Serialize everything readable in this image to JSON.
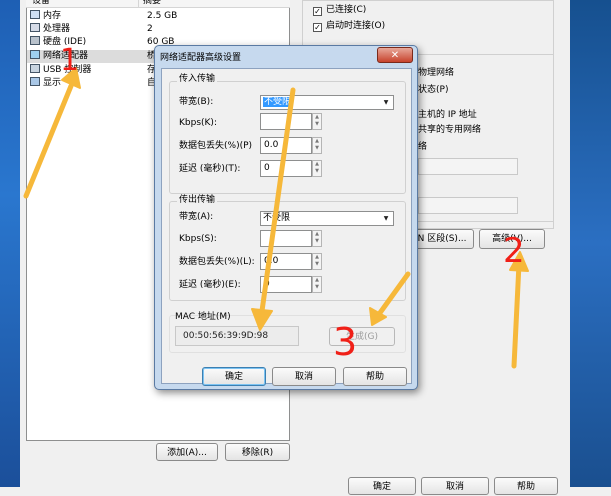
{
  "parent_window": {
    "columns": {
      "device": "设备",
      "summary": "摘要"
    },
    "devices": [
      {
        "name": "内存",
        "summary": "2.5 GB",
        "icon": "memory-icon"
      },
      {
        "name": "处理器",
        "summary": "2",
        "icon": "cpu-icon"
      },
      {
        "name": "硬盘 (IDE)",
        "summary": "60 GB",
        "icon": "disk-icon"
      },
      {
        "name": "网络适配器",
        "summary": "桥",
        "icon": "network-icon"
      },
      {
        "name": "USB 控制器",
        "summary": "存",
        "icon": "usb-icon"
      },
      {
        "name": "显示",
        "summary": "自",
        "icon": "display-icon"
      }
    ],
    "connected_label": "已连接(C)",
    "connect_on_start_label": "启动时连接(O)",
    "right_texts": [
      "物理网络",
      "状态(P)",
      "主机的 IP 地址",
      "共享的专用网络",
      "络"
    ],
    "lan_segment_button": "AN 区段(S)...",
    "advanced_button": "高级(V)...",
    "add_button": "添加(A)...",
    "remove_button": "移除(R)",
    "bottom_buttons": [
      "确定",
      "取消",
      "帮助"
    ]
  },
  "dialog": {
    "title": "网络适配器高级设置",
    "close_glyph": "✕",
    "incoming": {
      "title": "传入传输",
      "bandwidth_label": "带宽(B):",
      "bandwidth_value": "不受限",
      "kbps_label": "Kbps(K):",
      "kbps_value": "",
      "loss_label": "数据包丢失(%)(P)",
      "loss_value": "0.0",
      "latency_label": "延迟 (毫秒)(T):",
      "latency_value": "0"
    },
    "outgoing": {
      "title": "传出传输",
      "bandwidth_label": "带宽(A):",
      "bandwidth_value": "不受限",
      "kbps_label": "Kbps(S):",
      "kbps_value": "",
      "loss_label": "数据包丢失(%)(L):",
      "loss_value": "0.0",
      "latency_label": "延迟 (毫秒)(E):",
      "latency_value": "0"
    },
    "mac": {
      "title": "MAC 地址(M)",
      "value": "00:50:56:39:9D:98",
      "generate_button": "生成(G)"
    },
    "ok_button": "确定",
    "cancel_button": "取消",
    "help_button": "帮助"
  },
  "annotations": {
    "numbers": [
      "1",
      "2",
      "3"
    ],
    "arrow_color": "#f6b83a",
    "number_color": "#f02018"
  }
}
